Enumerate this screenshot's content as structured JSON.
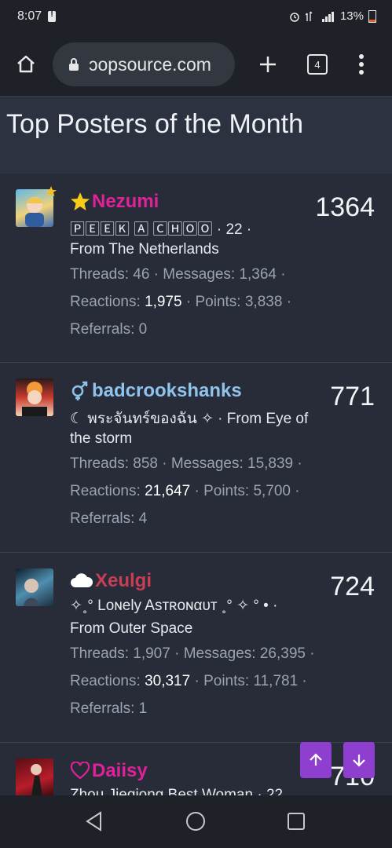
{
  "status_bar": {
    "time": "8:07",
    "battery": "13%"
  },
  "browser": {
    "url": "ɔopsource.com",
    "tab_count": "4"
  },
  "page": {
    "title": "Top Posters of the Month"
  },
  "posters": [
    {
      "username": "Nezumi",
      "badge_icon": "star-icon",
      "name_color": "#e0219a",
      "count": "1364",
      "title_line": "🄿🄴🄴🄺 🄰 🄲🄷🄾🄾 · 22 ·",
      "location_line": "From The Netherlands",
      "threads_label": "Threads: 46",
      "messages_label": "Messages: 1,364",
      "reactions_label": "Reactions:",
      "reactions_value": "1,975",
      "points_label": "Points: 3,838",
      "referrals_label": "Referrals: 0"
    },
    {
      "username": "badcrookshanks",
      "badge_icon": "gender-icon",
      "name_color": "#8fc3ec",
      "count": "771",
      "title_line": "☾ พระจันทร์ของฉัน ✧ · From Eye of",
      "location_line": "the storm",
      "threads_label": "Threads: 858",
      "messages_label": "Messages: 15,839",
      "reactions_label": "Reactions:",
      "reactions_value": "21,647",
      "points_label": "Points: 5,700",
      "referrals_label": "Referrals: 4"
    },
    {
      "username": "Xeulgi",
      "badge_icon": "cloud-icon",
      "name_color": "#c93d57",
      "count": "724",
      "title_line": "✧˳° Lᴏɴely Asᴛʀᴏɴαᴜᴛ ˳° ✧ ° • ·",
      "location_line": "From Outer Space",
      "threads_label": "Threads: 1,907",
      "messages_label": "Messages: 26,395",
      "reactions_label": "Reactions:",
      "reactions_value": "30,317",
      "points_label": "Points: 11,781",
      "referrals_label": "Referrals: 1"
    },
    {
      "username": "Daiisy",
      "badge_icon": "heart-icon",
      "name_color": "#e0219a",
      "count": "710",
      "title_line": "Zhou Jieqiong Best Woman · 22",
      "location_line": "",
      "threads_label": "",
      "messages_label": "",
      "reactions_label": "",
      "reactions_value": "",
      "points_label": "",
      "referrals_label": ""
    }
  ],
  "colors": {
    "accent_fab": "#8f3fd0",
    "background": "#252a35",
    "header_bg": "#2c3240"
  }
}
